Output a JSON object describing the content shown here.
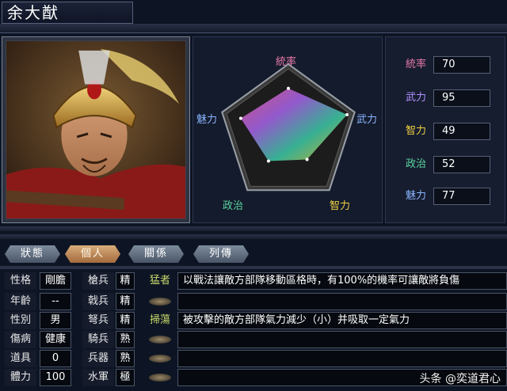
{
  "officer": {
    "name": "余大猷"
  },
  "radar": {
    "labels": [
      {
        "text": "統率",
        "color": "#e879a8"
      },
      {
        "text": "武力",
        "color": "#8ab4ff"
      },
      {
        "text": "智力",
        "color": "#f0d040"
      },
      {
        "text": "政治",
        "color": "#59d4a0"
      },
      {
        "text": "魅力",
        "color": "#8ab4ff"
      }
    ],
    "max": 100
  },
  "stats": [
    {
      "label": "統率",
      "value": "70",
      "num": 70,
      "color": "#e879a8"
    },
    {
      "label": "武力",
      "value": "95",
      "num": 95,
      "color": "#b090ff"
    },
    {
      "label": "智力",
      "value": "49",
      "num": 49,
      "color": "#f0d040"
    },
    {
      "label": "政治",
      "value": "52",
      "num": 52,
      "color": "#59d4a0"
    },
    {
      "label": "魅力",
      "value": "77",
      "num": 77,
      "color": "#8ab4ff"
    }
  ],
  "tabs": [
    {
      "label": "狀態",
      "active": false
    },
    {
      "label": "個人",
      "active": true
    },
    {
      "label": "關係",
      "active": false
    },
    {
      "label": "列傳",
      "active": false
    }
  ],
  "attributes": [
    {
      "label": "性格",
      "value": "剛膽",
      "troop": "槍兵",
      "rank": "精",
      "skill": "猛者",
      "desc": "以戰法讓敵方部隊移動區格時，有100%的機率可讓敵將負傷"
    },
    {
      "label": "年齡",
      "value": "--",
      "troop": "戟兵",
      "rank": "精",
      "skill": "",
      "desc": ""
    },
    {
      "label": "性別",
      "value": "男",
      "troop": "弩兵",
      "rank": "精",
      "skill": "掃蕩",
      "desc": "被攻擊的敵方部隊氣力減少（小）并吸取一定氣力"
    },
    {
      "label": "傷病",
      "value": "健康",
      "troop": "騎兵",
      "rank": "熟",
      "skill": "",
      "desc": ""
    },
    {
      "label": "道具",
      "value": "0",
      "troop": "兵器",
      "rank": "熟",
      "skill": "",
      "desc": ""
    },
    {
      "label": "體力",
      "value": "100",
      "troop": "水軍",
      "rank": "極",
      "skill": "",
      "desc": ""
    }
  ],
  "watermark": "头条 @奕道君心",
  "colors": {
    "accent_tab": "#c08a58",
    "label_text": "#ffffff"
  }
}
